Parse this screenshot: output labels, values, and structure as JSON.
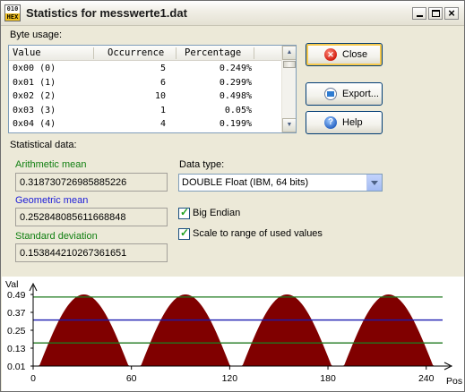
{
  "window": {
    "title": "Statistics for messwerte1.dat",
    "icon_text_top": "010",
    "icon_text_bottom": "HEX"
  },
  "byte_usage": {
    "label": "Byte usage:",
    "columns": [
      "Value",
      "Occurrence",
      "Percentage"
    ],
    "rows": [
      {
        "value": "0x00 (0)",
        "occurrence": "5",
        "percentage": "0.249%"
      },
      {
        "value": "0x01 (1)",
        "occurrence": "6",
        "percentage": "0.299%"
      },
      {
        "value": "0x02 (2)",
        "occurrence": "10",
        "percentage": "0.498%"
      },
      {
        "value": "0x03 (3)",
        "occurrence": "1",
        "percentage": "0.05%"
      },
      {
        "value": "0x04 (4)",
        "occurrence": "4",
        "percentage": "0.199%"
      }
    ]
  },
  "buttons": {
    "close": "Close",
    "export": "Export...",
    "help": "Help"
  },
  "statistics": {
    "label": "Statistical data:",
    "arithmetic_mean_label": "Arithmetic mean",
    "arithmetic_mean": "0.318730726985885226",
    "geometric_mean_label": "Geometric mean",
    "geometric_mean": "0.252848085611668848",
    "std_dev_label": "Standard deviation",
    "std_dev": "0.153844210267361651"
  },
  "options": {
    "data_type_label": "Data type:",
    "data_type_value": "DOUBLE Float (IBM, 64 bits)",
    "big_endian_label": "Big Endian",
    "big_endian_checked": true,
    "scale_label": "Scale to range of used values",
    "scale_checked": true
  },
  "colors": {
    "area": "#800000",
    "mean_line": "#1a1ab0",
    "std_lines": "#1e7a1e"
  },
  "chart_data": {
    "type": "area",
    "ylabel": "Val",
    "xlabel": "Pos",
    "ylim": [
      0.01,
      0.49
    ],
    "xlim": [
      0,
      250
    ],
    "y_ticks": [
      "0.01",
      "0.13",
      "0.25",
      "0.37",
      "0.49"
    ],
    "x_ticks": [
      "0",
      "60",
      "120",
      "180",
      "240"
    ],
    "period": 62,
    "min_value": 0.01,
    "max_value": 0.49,
    "mean": 0.3187,
    "mean_minus_std": 0.1649,
    "mean_plus_std": 0.4726
  }
}
